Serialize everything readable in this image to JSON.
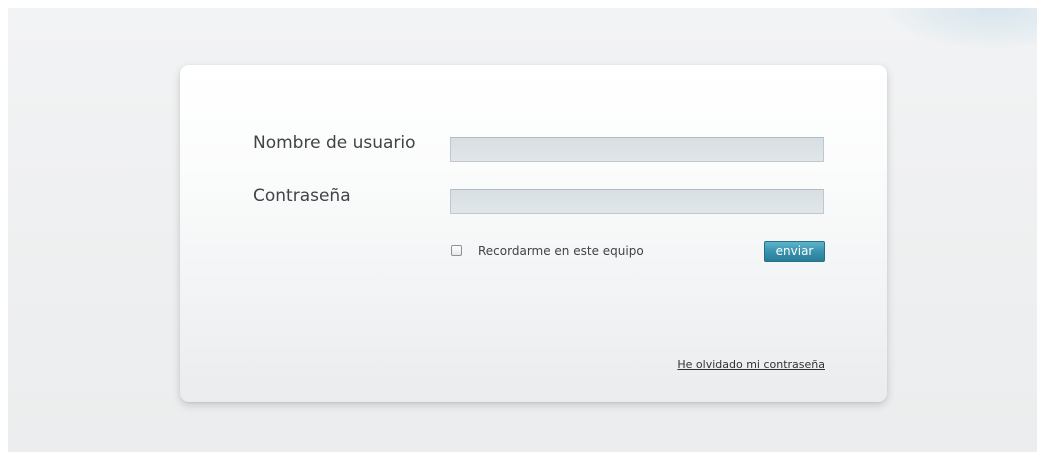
{
  "login_form": {
    "username_label": "Nombre de usuario",
    "username_value": "",
    "password_label": "Contraseña",
    "password_value": "",
    "remember_label": "Recordarme en este equipo",
    "remember_checked": false,
    "submit_label": "enviar",
    "forgot_password_label": "He olvidado mi contraseña"
  },
  "colors": {
    "accent": "#3a92ae",
    "page_background": "#eeeff0",
    "card_background": "#f7f8f9",
    "input_background": "#dde3e6",
    "text": "#3f4448"
  }
}
